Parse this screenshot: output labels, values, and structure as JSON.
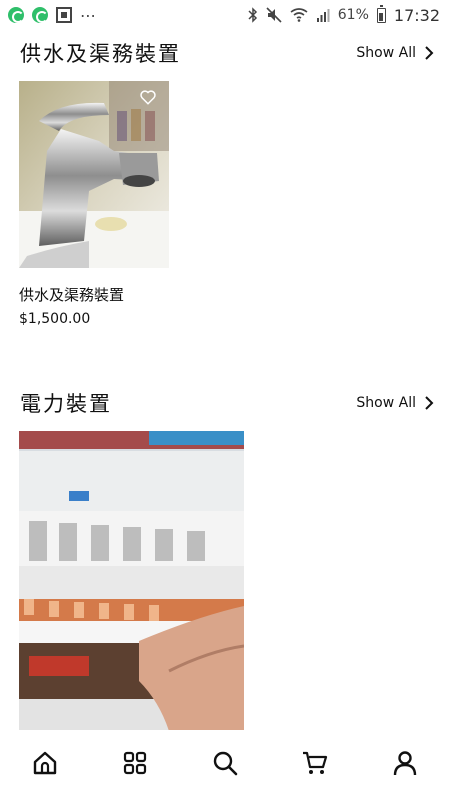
{
  "status_bar": {
    "battery_percent": "61%",
    "time": "17:32",
    "more": "⋯"
  },
  "sections": [
    {
      "title": "供水及渠務裝置",
      "show_all_label": "Show All",
      "products": [
        {
          "title": "供水及渠務裝置",
          "price": "$1,500.00",
          "image": "faucet"
        }
      ]
    },
    {
      "title": "電力裝置",
      "show_all_label": "Show All",
      "products": [
        {
          "image": "circuit-breakers"
        }
      ]
    }
  ],
  "bottom_nav": [
    {
      "name": "home",
      "icon": "home-icon"
    },
    {
      "name": "categories",
      "icon": "grid-icon"
    },
    {
      "name": "search",
      "icon": "search-icon"
    },
    {
      "name": "cart",
      "icon": "cart-icon"
    },
    {
      "name": "account",
      "icon": "user-icon"
    }
  ],
  "colors": {
    "text": "#111111",
    "background": "#ffffff"
  }
}
